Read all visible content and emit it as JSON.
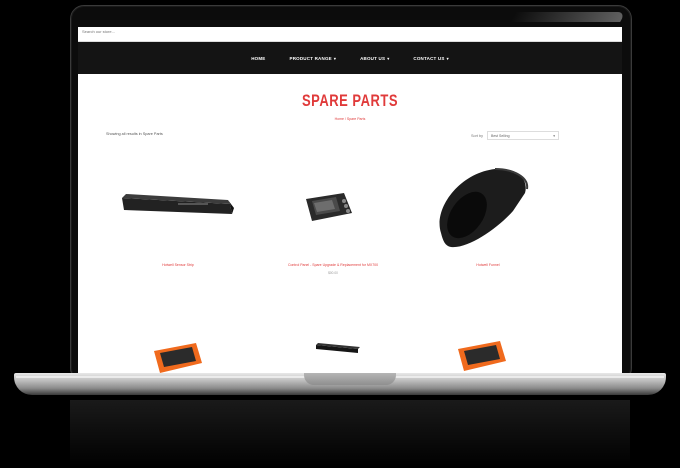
{
  "search": {
    "placeholder": "Search our store..."
  },
  "nav": {
    "items": [
      {
        "label": "HOME",
        "caret": ""
      },
      {
        "label": "PRODUCT RANGE",
        "caret": "▾"
      },
      {
        "label": "ABOUT US",
        "caret": "▾"
      },
      {
        "label": "CONTACT US",
        "caret": "▾"
      }
    ]
  },
  "page": {
    "title": "SPARE PARTS",
    "breadcrumb_center": "Home  /  Spare Parts",
    "breadcrumb_left": "Showing all results in Spare Parts"
  },
  "sort": {
    "label": "Sort by",
    "value": "Best Selling",
    "caret": "▾"
  },
  "products": [
    {
      "label": "Hotwell Sensor Strip"
    },
    {
      "label": "Control Panel - Spare Upgrade & Replacement for MX700",
      "sub": "$00.00"
    },
    {
      "label": "Hotwell Funnel"
    }
  ],
  "colors": {
    "accent": "#e03a3a",
    "nav_bg": "#141414",
    "orange": "#f06a1d"
  }
}
